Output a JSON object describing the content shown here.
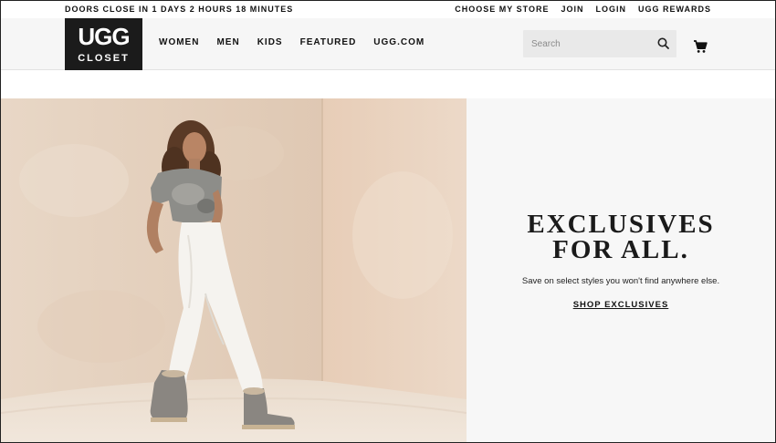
{
  "topbar": {
    "countdown": "DOORS CLOSE IN 1 DAYS 2 HOURS 18 MINUTES",
    "links": [
      "CHOOSE MY STORE",
      "JOIN",
      "LOGIN",
      "UGG REWARDS"
    ]
  },
  "header": {
    "logo_word": "UGG",
    "logo_sub": "CLOSET",
    "nav": [
      "WOMEN",
      "MEN",
      "KIDS",
      "FEATURED",
      "UGG.COM"
    ],
    "search_placeholder": "Search",
    "search_icon": "search-icon",
    "cart_icon": "cart-icon"
  },
  "hero": {
    "headline_line1": "EXCLUSIVES",
    "headline_line2": "FOR ALL.",
    "subtext": "Save on select styles you won't find anywhere else.",
    "cta_label": "SHOP EXCLUSIVES"
  }
}
